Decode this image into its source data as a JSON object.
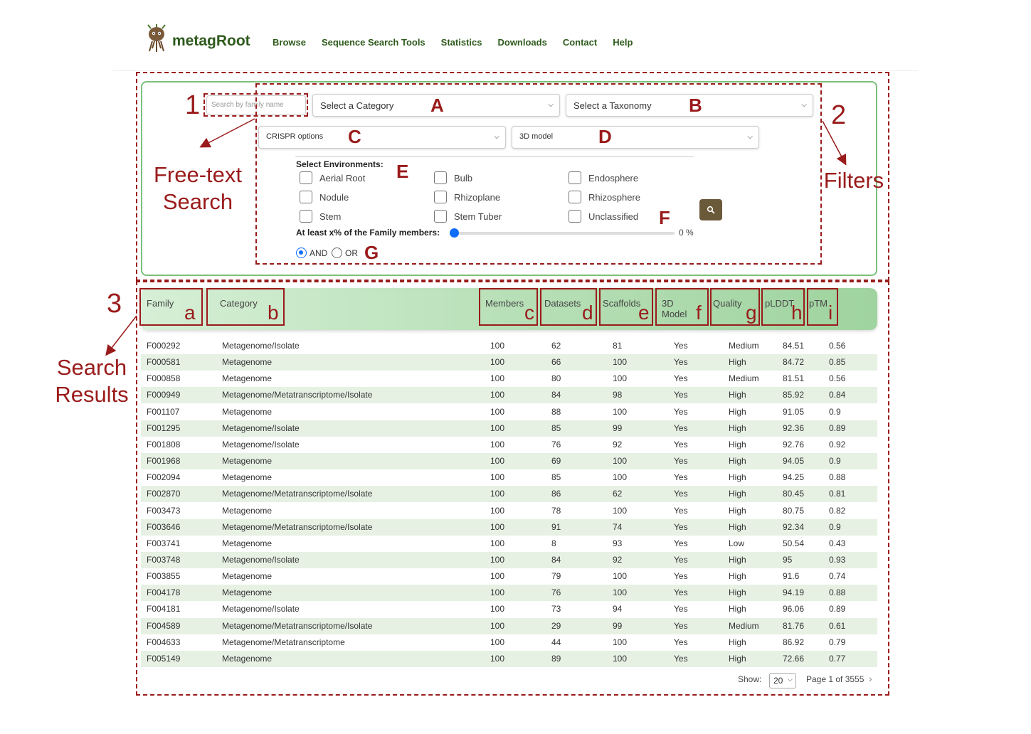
{
  "nav": {
    "brand": "metagRoot",
    "menu": [
      "Browse",
      "Sequence Search Tools",
      "Statistics",
      "Downloads",
      "Contact",
      "Help"
    ]
  },
  "filters": {
    "search_placeholder": "Search by family name",
    "category_select": "Select a Category",
    "taxonomy_select": "Select a Taxonomy",
    "crispr_select": "CRISPR options",
    "model_select": "3D model",
    "env_title": "Select Environments:",
    "environments": [
      "Aerial Root",
      "Bulb",
      "Endosphere",
      "Nodule",
      "Rhizoplane",
      "Rhizosphere",
      "Stem",
      "Stem Tuber",
      "Unclassified"
    ],
    "slider_label": "At least x% of the Family members:",
    "slider_value_text": "0 %",
    "slider_value": 0,
    "radio_and": "AND",
    "radio_or": "OR"
  },
  "annotations": {
    "num1": "1",
    "num2": "2",
    "num3": "3",
    "free_text_line1": "Free-text",
    "free_text_line2": "Search",
    "filters_label": "Filters",
    "results_line1": "Search",
    "results_line2": "Results",
    "upper": [
      "A",
      "B",
      "C",
      "D",
      "E",
      "F",
      "G"
    ],
    "lower": [
      "a",
      "b",
      "c",
      "d",
      "e",
      "f",
      "g",
      "h",
      "i"
    ]
  },
  "table": {
    "headers": [
      "Family",
      "Category",
      "Members",
      "Datasets",
      "Scaffolds",
      "3D Model",
      "Quality",
      "pLDDT",
      "pTM"
    ],
    "rows": [
      [
        "F000292",
        "Metagenome/Isolate",
        "100",
        "62",
        "81",
        "Yes",
        "Medium",
        "84.51",
        "0.56"
      ],
      [
        "F000581",
        "Metagenome",
        "100",
        "66",
        "100",
        "Yes",
        "High",
        "84.72",
        "0.85"
      ],
      [
        "F000858",
        "Metagenome",
        "100",
        "80",
        "100",
        "Yes",
        "Medium",
        "81.51",
        "0.56"
      ],
      [
        "F000949",
        "Metagenome/Metatranscriptome/Isolate",
        "100",
        "84",
        "98",
        "Yes",
        "High",
        "85.92",
        "0.84"
      ],
      [
        "F001107",
        "Metagenome",
        "100",
        "88",
        "100",
        "Yes",
        "High",
        "91.05",
        "0.9"
      ],
      [
        "F001295",
        "Metagenome/Isolate",
        "100",
        "85",
        "99",
        "Yes",
        "High",
        "92.36",
        "0.89"
      ],
      [
        "F001808",
        "Metagenome/Isolate",
        "100",
        "76",
        "92",
        "Yes",
        "High",
        "92.76",
        "0.92"
      ],
      [
        "F001968",
        "Metagenome",
        "100",
        "69",
        "100",
        "Yes",
        "High",
        "94.05",
        "0.9"
      ],
      [
        "F002094",
        "Metagenome",
        "100",
        "85",
        "100",
        "Yes",
        "High",
        "94.25",
        "0.88"
      ],
      [
        "F002870",
        "Metagenome/Metatranscriptome/Isolate",
        "100",
        "86",
        "62",
        "Yes",
        "High",
        "80.45",
        "0.81"
      ],
      [
        "F003473",
        "Metagenome",
        "100",
        "78",
        "100",
        "Yes",
        "High",
        "80.75",
        "0.82"
      ],
      [
        "F003646",
        "Metagenome/Metatranscriptome/Isolate",
        "100",
        "91",
        "74",
        "Yes",
        "High",
        "92.34",
        "0.9"
      ],
      [
        "F003741",
        "Metagenome",
        "100",
        "8",
        "93",
        "Yes",
        "Low",
        "50.54",
        "0.43"
      ],
      [
        "F003748",
        "Metagenome/Isolate",
        "100",
        "84",
        "92",
        "Yes",
        "High",
        "95",
        "0.93"
      ],
      [
        "F003855",
        "Metagenome",
        "100",
        "79",
        "100",
        "Yes",
        "High",
        "91.6",
        "0.74"
      ],
      [
        "F004178",
        "Metagenome",
        "100",
        "76",
        "100",
        "Yes",
        "High",
        "94.19",
        "0.88"
      ],
      [
        "F004181",
        "Metagenome/Isolate",
        "100",
        "73",
        "94",
        "Yes",
        "High",
        "96.06",
        "0.89"
      ],
      [
        "F004589",
        "Metagenome/Metatranscriptome/Isolate",
        "100",
        "29",
        "99",
        "Yes",
        "Medium",
        "81.76",
        "0.61"
      ],
      [
        "F004633",
        "Metagenome/Metatranscriptome",
        "100",
        "44",
        "100",
        "Yes",
        "High",
        "86.92",
        "0.79"
      ],
      [
        "F005149",
        "Metagenome",
        "100",
        "89",
        "100",
        "Yes",
        "High",
        "72.66",
        "0.77"
      ]
    ]
  },
  "pagination": {
    "show_label": "Show:",
    "show_value": "20",
    "page_text": "Page 1 of 3555"
  }
}
